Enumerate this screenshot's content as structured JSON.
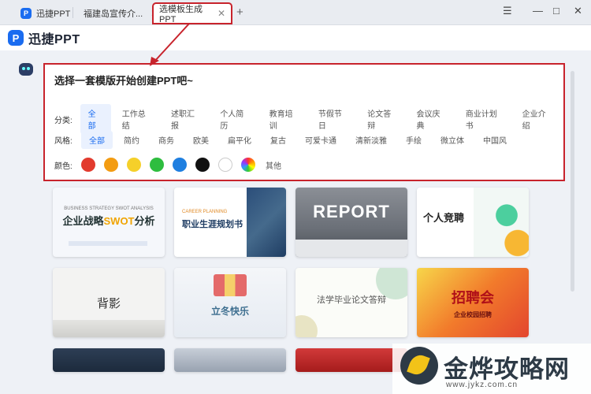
{
  "tabs": [
    {
      "label": "迅捷PPT"
    },
    {
      "label": "福建岛宣传介..."
    },
    {
      "label": "选模板生成PPT"
    }
  ],
  "window": {
    "menu": "☰",
    "minimize": "—",
    "maximize": "□",
    "close": "✕"
  },
  "app": {
    "name": "迅捷PPT",
    "logo_letter": "P"
  },
  "panel": {
    "title": "选择一套模版开始创建PPT吧~",
    "category_label": "分类:",
    "categories": [
      "全部",
      "工作总结",
      "述职汇报",
      "个人简历",
      "教育培训",
      "节假节日",
      "论文答辩",
      "会议庆典",
      "商业计划书",
      "企业介绍"
    ],
    "style_label": "风格:",
    "styles": [
      "全部",
      "简约",
      "商务",
      "欧美",
      "扁平化",
      "复古",
      "可爱卡通",
      "清新淡雅",
      "手绘",
      "微立体",
      "中国风"
    ],
    "color_label": "颜色:",
    "colors": [
      "#e23b2e",
      "#f39c12",
      "#f5d02a",
      "#2ebd3f",
      "#1f7fe0",
      "#111111",
      "#ffffff"
    ],
    "color_other": "其他"
  },
  "templates": [
    {
      "title_a": "企业战略",
      "title_b": "SWOT",
      "title_c": "分析",
      "sub": "BUSINESS STRATEGY SWOT ANALYSIS"
    },
    {
      "title": "职业生涯规划书",
      "sub": "CAREER PLANNING"
    },
    {
      "title": "REPORT"
    },
    {
      "title": "个人竞聘"
    },
    {
      "title": "背影"
    },
    {
      "title": "立冬快乐"
    },
    {
      "title": "法学毕业论文答辩"
    },
    {
      "title": "招聘会",
      "sub": "企业校园招聘"
    }
  ],
  "watermark": {
    "text": "金烨攻略网",
    "url": "www.jykz.com.cn"
  }
}
